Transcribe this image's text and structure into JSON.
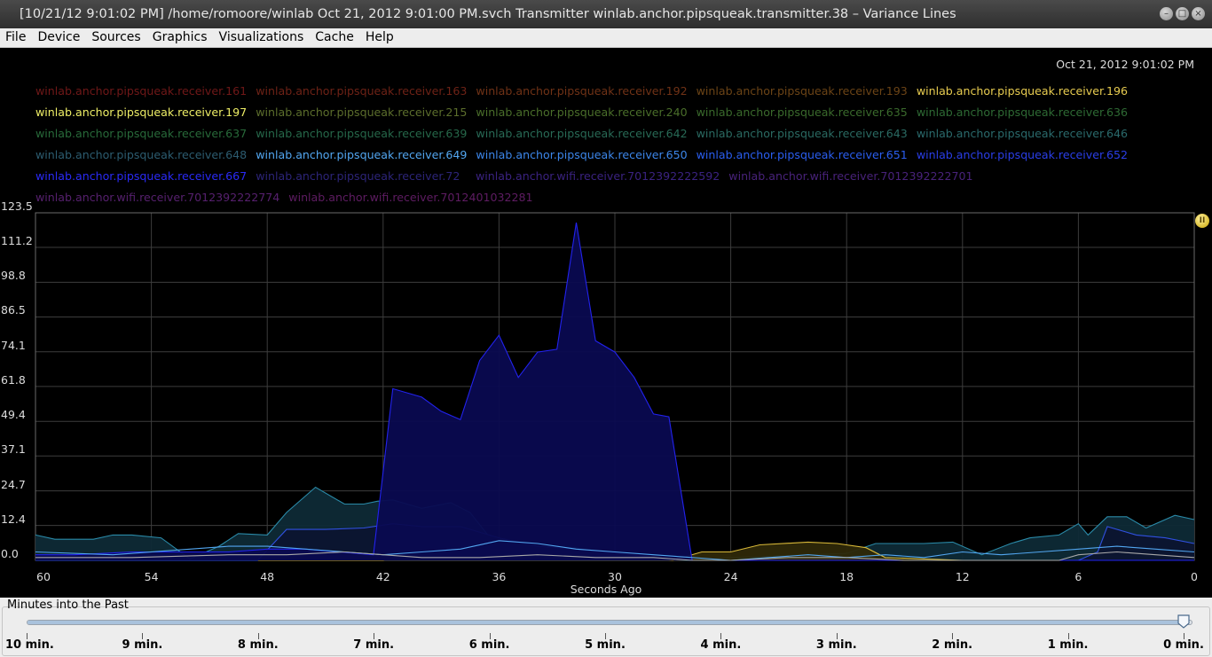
{
  "window": {
    "title": "[10/21/12 9:01:02 PM] /home/romoore/winlab Oct 21, 2012 9:01:00 PM.svch Transmitter winlab.anchor.pipsqueak.transmitter.38 – Variance Lines"
  },
  "menu": [
    "File",
    "Device",
    "Sources",
    "Graphics",
    "Visualizations",
    "Cache",
    "Help"
  ],
  "timestamp": "Oct 21, 2012 9:01:02 PM",
  "legend": [
    {
      "label": "winlab.anchor.pipsqueak.receiver.161",
      "color": "#701818"
    },
    {
      "label": "winlab.anchor.pipsqueak.receiver.163",
      "color": "#6e2216"
    },
    {
      "label": "winlab.anchor.pipsqueak.receiver.192",
      "color": "#703216"
    },
    {
      "label": "winlab.anchor.pipsqueak.receiver.193",
      "color": "#6c4416"
    },
    {
      "label": "winlab.anchor.pipsqueak.receiver.196",
      "color": "#e8cc50"
    },
    {
      "label": "winlab.anchor.pipsqueak.receiver.197",
      "color": "#eeee66"
    },
    {
      "label": "winlab.anchor.pipsqueak.receiver.215",
      "color": "#5c6e2c"
    },
    {
      "label": "winlab.anchor.pipsqueak.receiver.240",
      "color": "#4a6e2a"
    },
    {
      "label": "winlab.anchor.pipsqueak.receiver.635",
      "color": "#3a6a2c"
    },
    {
      "label": "winlab.anchor.pipsqueak.receiver.636",
      "color": "#2e6a34"
    },
    {
      "label": "winlab.anchor.pipsqueak.receiver.637",
      "color": "#286a3a"
    },
    {
      "label": "winlab.anchor.pipsqueak.receiver.639",
      "color": "#26684a"
    },
    {
      "label": "winlab.anchor.pipsqueak.receiver.642",
      "color": "#286a56"
    },
    {
      "label": "winlab.anchor.pipsqueak.receiver.643",
      "color": "#2a6a62"
    },
    {
      "label": "winlab.anchor.pipsqueak.receiver.646",
      "color": "#2a6a6c"
    },
    {
      "label": "winlab.anchor.pipsqueak.receiver.648",
      "color": "#2c5c70"
    },
    {
      "label": "winlab.anchor.pipsqueak.receiver.649",
      "color": "#52a6f0"
    },
    {
      "label": "winlab.anchor.pipsqueak.receiver.650",
      "color": "#3c86ea"
    },
    {
      "label": "winlab.anchor.pipsqueak.receiver.651",
      "color": "#2a5ef0"
    },
    {
      "label": "winlab.anchor.pipsqueak.receiver.652",
      "color": "#2a3ee8"
    },
    {
      "label": "winlab.anchor.pipsqueak.receiver.667",
      "color": "#2a2af6"
    },
    {
      "label": "winlab.anchor.pipsqueak.receiver.72",
      "color": "#2c2478"
    },
    {
      "label": "winlab.anchor.wifi.receiver.7012392222592",
      "color": "#3a2280"
    },
    {
      "label": "winlab.anchor.wifi.receiver.7012392222701",
      "color": "#48227a"
    },
    {
      "label": "winlab.anchor.wifi.receiver.7012392222774",
      "color": "#56206e"
    },
    {
      "label": "winlab.anchor.wifi.receiver.7012401032281",
      "color": "#5e1c62"
    }
  ],
  "chart_data": {
    "type": "area",
    "xlabel": "Seconds Ago",
    "ylabel": "",
    "xlim": [
      60,
      0
    ],
    "ylim": [
      0,
      123.5
    ],
    "xticks": [
      60,
      54,
      48,
      42,
      36,
      30,
      24,
      18,
      12,
      6,
      0
    ],
    "yticks": [
      0.0,
      12.4,
      24.7,
      37.1,
      49.4,
      61.8,
      74.1,
      86.5,
      98.8,
      111.2,
      123.5
    ],
    "grid": true,
    "series": [
      {
        "name": "winlab.anchor.pipsqueak.receiver.648",
        "color": "#2a8aa8",
        "fill": "#0e2a36",
        "x": [
          60,
          59,
          57,
          56,
          55,
          53.5,
          52,
          50.5,
          49.5,
          48,
          47,
          45.5,
          44,
          43,
          42.3,
          41.5,
          40,
          38.5,
          37.5,
          36,
          34,
          32,
          31,
          30,
          28,
          26,
          24,
          22,
          20,
          18,
          16.5,
          15,
          14,
          12.5,
          11,
          9.5,
          8.5,
          7,
          6,
          5.5,
          4.5,
          3.5,
          2.5,
          1,
          0
        ],
        "y": [
          9,
          7.5,
          7.5,
          9,
          9,
          8,
          0.5,
          5,
          9.5,
          9,
          17,
          26,
          20,
          20,
          21,
          21.5,
          18.5,
          20.5,
          17,
          4,
          5,
          4.5,
          3,
          1,
          0.5,
          0,
          1,
          1.5,
          2,
          2.5,
          6,
          6,
          6,
          6.5,
          2,
          6,
          8,
          9,
          13,
          9,
          15.5,
          15.5,
          11.5,
          16,
          14.5
        ]
      },
      {
        "name": "winlab.anchor.pipsqueak.receiver.196",
        "color": "#d8b838",
        "fill": "#2e2808",
        "x": [
          60,
          44,
          42,
          40,
          37,
          33,
          30,
          27,
          25.5,
          24,
          22.5,
          20,
          18.5,
          17,
          16,
          12,
          0
        ],
        "y": [
          0,
          0,
          0,
          4,
          4,
          3,
          2,
          0,
          3,
          3,
          5.5,
          6.5,
          6,
          4.5,
          1,
          0,
          0
        ]
      },
      {
        "name": "winlab.anchor.pipsqueak.receiver.651",
        "color": "#3050e0",
        "fill": "#0c1430",
        "x": [
          60,
          48.5,
          47,
          45,
          43,
          41.5,
          40,
          38,
          36,
          34,
          32,
          30.5,
          28,
          26,
          24,
          22,
          20,
          18,
          16,
          14,
          12,
          10,
          8,
          6,
          5,
          4.5,
          3,
          1.5,
          0
        ],
        "y": [
          0,
          0,
          11,
          11,
          11.5,
          13,
          12,
          12,
          8,
          5,
          4,
          3,
          1,
          0,
          0,
          0,
          0,
          0,
          0,
          0,
          0,
          0,
          0,
          0,
          3,
          12,
          9,
          8,
          6
        ]
      },
      {
        "name": "winlab.anchor.pipsqueak.receiver.667",
        "color": "#2222ee",
        "fill": "#0a0a50",
        "x": [
          60,
          58,
          55,
          50,
          48,
          46,
          42.5,
          41.5,
          40,
          39,
          38,
          37,
          36,
          35,
          34,
          33,
          32,
          31,
          30,
          29,
          28,
          27.2,
          26,
          22,
          18,
          14,
          10,
          6,
          3,
          0
        ],
        "y": [
          2,
          2,
          3,
          3,
          4,
          4,
          2,
          61,
          58,
          53,
          50,
          71,
          80,
          65,
          74,
          75,
          120,
          78,
          74,
          65,
          52,
          51,
          0,
          0,
          0,
          0,
          0,
          0,
          0,
          0
        ]
      },
      {
        "name": "winlab.anchor.pipsqueak.receiver.649",
        "color": "#52a6f0",
        "fill": "none",
        "x": [
          60,
          56,
          52,
          50,
          48,
          46,
          44,
          42,
          40,
          38,
          36,
          34,
          32,
          30,
          28,
          26,
          24,
          22,
          20,
          18,
          16,
          14,
          12,
          10,
          8,
          6,
          4,
          2,
          0
        ],
        "y": [
          3,
          2,
          4,
          5,
          5,
          4,
          3,
          2,
          3,
          4,
          7,
          6,
          4,
          3,
          2,
          1,
          0,
          1,
          2,
          1,
          2,
          1,
          3,
          2,
          3,
          4,
          5,
          4,
          3
        ]
      },
      {
        "name": "winlab.anchor.pipsqueak.receiver.215",
        "color": "#a8a8a8",
        "fill": "none",
        "x": [
          60,
          55,
          50,
          47,
          44,
          42,
          40,
          37,
          34,
          31,
          28,
          26,
          24,
          21,
          18,
          15,
          12,
          9,
          7,
          6,
          4,
          2,
          0
        ],
        "y": [
          1,
          1,
          2,
          2,
          3,
          2,
          1,
          1,
          2,
          1,
          1,
          0,
          0,
          1,
          1,
          0,
          0,
          0,
          0,
          2,
          3,
          2,
          1
        ]
      }
    ]
  },
  "slider": {
    "title": "Minutes into the Past",
    "labels": [
      "10 min.",
      "9 min.",
      "8 min.",
      "7 min.",
      "6 min.",
      "5 min.",
      "4 min.",
      "3 min.",
      "2 min.",
      "1 min.",
      "0 min."
    ],
    "value": 0
  }
}
